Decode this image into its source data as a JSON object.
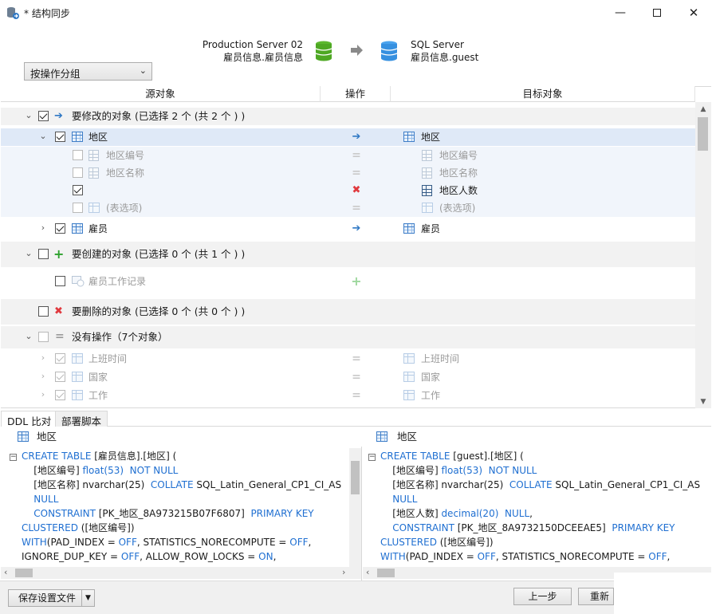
{
  "window": {
    "title": "* 结构同步",
    "minimize": "—",
    "maximize": "☐",
    "close": "✕"
  },
  "header": {
    "source_server": "Production Server 02",
    "source_db": "雇员信息.雇员信息",
    "target_server": "SQL Server",
    "target_db": "雇员信息.guest"
  },
  "group_by": {
    "value": "按操作分组"
  },
  "columns": {
    "source": "源对象",
    "operation": "操作",
    "target": "目标对象"
  },
  "tree": {
    "modify_group": "要修改的对象 (已选择 2 个 (共 2 个 ) )",
    "t1": {
      "src": "地区",
      "tgt": "地区"
    },
    "t1_cols": [
      {
        "src": "地区编号",
        "tgt": "地区编号"
      },
      {
        "src": "地区名称",
        "tgt": "地区名称"
      },
      {
        "src": "",
        "tgt": "地区人数"
      },
      {
        "src": "(表选项)",
        "tgt": "(表选项)"
      }
    ],
    "t2": {
      "src": "雇员",
      "tgt": "雇员"
    },
    "create_group": "要创建的对象 (已选择 0 个 (共 1 个 ) )",
    "create_item": "雇员工作记录",
    "delete_group": "要删除的对象 (已选择 0 个 (共 0 个 ) )",
    "noop_group": "没有操作（7个对象）",
    "noop_items": [
      {
        "src": "上班时间",
        "tgt": "上班时间"
      },
      {
        "src": "国家",
        "tgt": "国家"
      },
      {
        "src": "工作",
        "tgt": "工作"
      }
    ]
  },
  "tabs": {
    "ddl": "DDL 比对",
    "deploy": "部署脚本"
  },
  "ddl": {
    "left_title": "地区",
    "right_title": "地区",
    "left": {
      "l1a": "CREATE TABLE",
      "l1b": " [雇员信息].[地区] (",
      "l2a": "    [地区编号] ",
      "l2b": "float",
      "l2c": "(53)  ",
      "l2d": "NOT NULL",
      "l3a": "    [地区名称] nvarchar(25)  ",
      "l3b": "COLLATE",
      "l3c": " SQL_Latin_General_CP1_CI_AS",
      "l4": "    NULL",
      "l5a": "    CONSTRAINT",
      "l5b": " [PK_地区_8A973215B07F6807]  ",
      "l5c": "PRIMARY KEY",
      "l6a": "CLUSTERED",
      "l6b": " ([地区编号])",
      "l7a": "WITH",
      "l7b": "(PAD_INDEX = ",
      "l7c": "OFF",
      "l7d": ", STATISTICS_NORECOMPUTE = ",
      "l7e": "OFF",
      "l8a": "IGNORE_DUP_KEY = ",
      "l8b": "OFF",
      "l8c": ", ALLOW_ROW_LOCKS = ",
      "l8d": "ON"
    },
    "right": {
      "l1a": "CREATE TABLE",
      "l1b": " [guest].[地区] (",
      "l2a": "    [地区编号] ",
      "l2b": "float",
      "l2c": "(53)  ",
      "l2d": "NOT NULL",
      "l3a": "    [地区名称] nvarchar(25)  ",
      "l3b": "COLLATE",
      "l3c": " SQL_Latin_General_CP1_CI_AS",
      "l4": "    NULL",
      "l5a": "    [地区人数] ",
      "l5b": "decimal",
      "l5c": "(20)  ",
      "l5d": "NULL",
      "l6a": "    CONSTRAINT",
      "l6b": " [PK_地区_8A9732150DCEEAE5]  ",
      "l6c": "PRIMARY KEY",
      "l7a": "CLUSTERED",
      "l7b": " ([地区编号])",
      "l8a": "WITH",
      "l8b": "(PAD_INDEX = ",
      "l8c": "OFF",
      "l8d": ", STATISTICS_NORECOMPUTE = ",
      "l8e": "OFF"
    }
  },
  "footer": {
    "save": "保存设置文件",
    "prev": "上一步",
    "rerun": "重新比"
  },
  "colors": {
    "accent": "#2f78c4",
    "keyword": "#1f6fd1",
    "delete": "#e0393e",
    "create": "#2ca02c"
  }
}
